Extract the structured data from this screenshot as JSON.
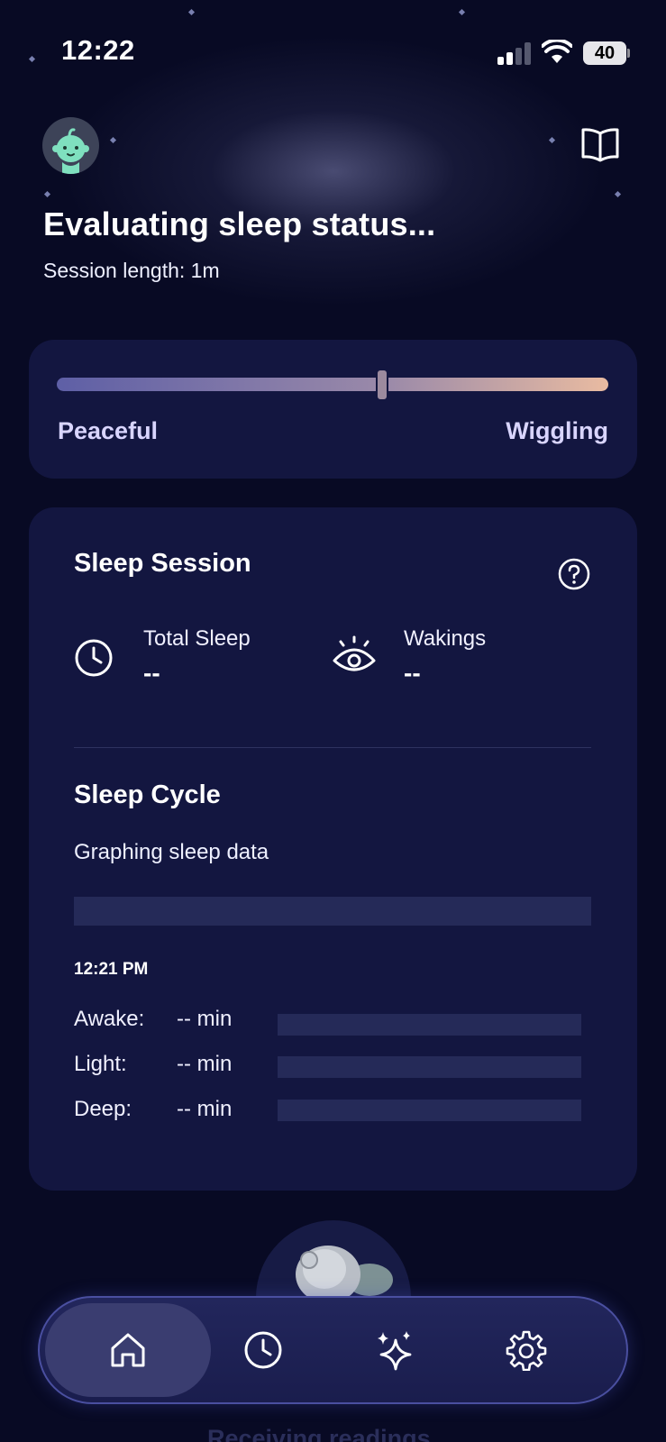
{
  "status_bar": {
    "time": "12:22",
    "battery": "40"
  },
  "header": {
    "title": "Evaluating sleep status...",
    "session_length": "Session length: 1m"
  },
  "motion_slider": {
    "level": 0.59,
    "left_label": "Peaceful",
    "right_label": "Wiggling"
  },
  "sleep_session": {
    "title": "Sleep Session",
    "total_sleep": {
      "label": "Total Sleep",
      "value": "--"
    },
    "wakings": {
      "label": "Wakings",
      "value": "--"
    }
  },
  "sleep_cycle": {
    "title": "Sleep Cycle",
    "caption": "Graphing sleep data",
    "start_time": "12:21 PM",
    "rows": [
      {
        "label": "Awake:",
        "value": "-- min"
      },
      {
        "label": "Light:",
        "value": "-- min"
      },
      {
        "label": "Deep:",
        "value": "-- min"
      }
    ]
  },
  "footer_peek": "Receiving readings",
  "nav": {
    "items": [
      {
        "icon": "home-icon",
        "active": true
      },
      {
        "icon": "clock-icon",
        "active": false
      },
      {
        "icon": "sparkles-icon",
        "active": false
      },
      {
        "icon": "gear-icon",
        "active": false
      }
    ]
  },
  "colors": {
    "background": "#080a24",
    "card": "#131640",
    "accent_label": "#d9d5ff",
    "slider_start": "#5e5fa6",
    "slider_end": "#e9bba1",
    "placeholder_bar": "#252a58"
  }
}
